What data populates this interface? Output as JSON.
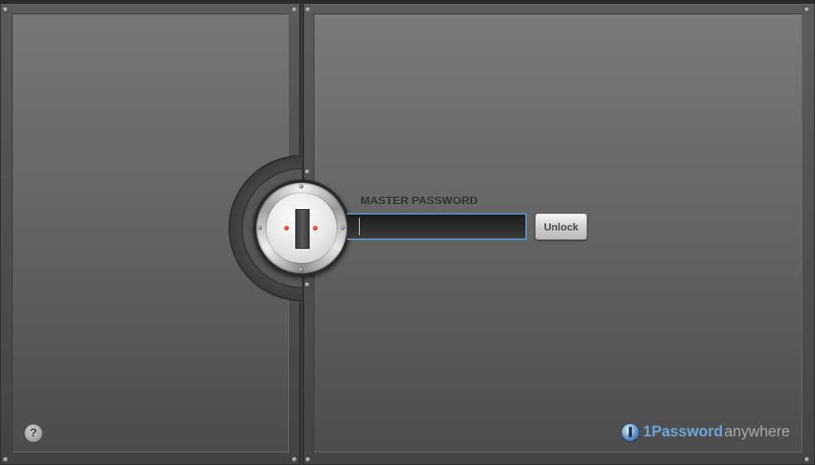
{
  "login": {
    "label": "MASTER PASSWORD",
    "password_value": "",
    "unlock_label": "Unlock"
  },
  "help": {
    "label": "?"
  },
  "logo": {
    "brand": "1Password",
    "suffix": "anywhere"
  },
  "colors": {
    "accent": "#5a8fc4",
    "logo_blue": "#6fa4d8"
  },
  "icons": {
    "lock": "vault-dial-icon",
    "help": "question-mark-icon",
    "logo": "1password-logo-icon"
  }
}
